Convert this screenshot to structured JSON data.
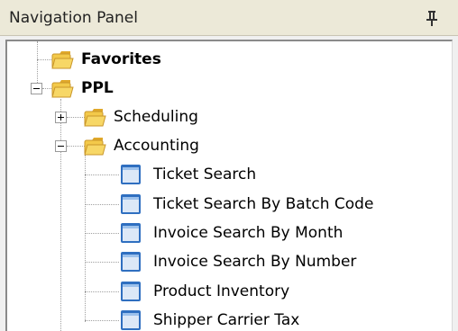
{
  "panel": {
    "title": "Navigation Panel",
    "pin_icon": "pin-icon"
  },
  "tree": {
    "favorites": {
      "label": "Favorites",
      "icon": "folder-icon"
    },
    "ppl": {
      "label": "PPL",
      "icon": "folder-icon",
      "expanded": true,
      "scheduling": {
        "label": "Scheduling",
        "icon": "folder-icon",
        "expanded": false
      },
      "accounting": {
        "label": "Accounting",
        "icon": "folder-icon",
        "expanded": true,
        "items": [
          {
            "label": "Ticket Search",
            "icon": "page-icon"
          },
          {
            "label": "Ticket Search By Batch Code",
            "icon": "page-icon"
          },
          {
            "label": "Invoice Search By Month",
            "icon": "page-icon"
          },
          {
            "label": "Invoice Search By Number",
            "icon": "page-icon"
          },
          {
            "label": "Product Inventory",
            "icon": "page-icon"
          },
          {
            "label": "Shipper Carrier Tax",
            "icon": "page-icon"
          }
        ]
      }
    }
  },
  "colors": {
    "header_bg": "#ece9d8",
    "folder_yellow": "#f3c94a",
    "page_blue": "#3a7fd0"
  }
}
